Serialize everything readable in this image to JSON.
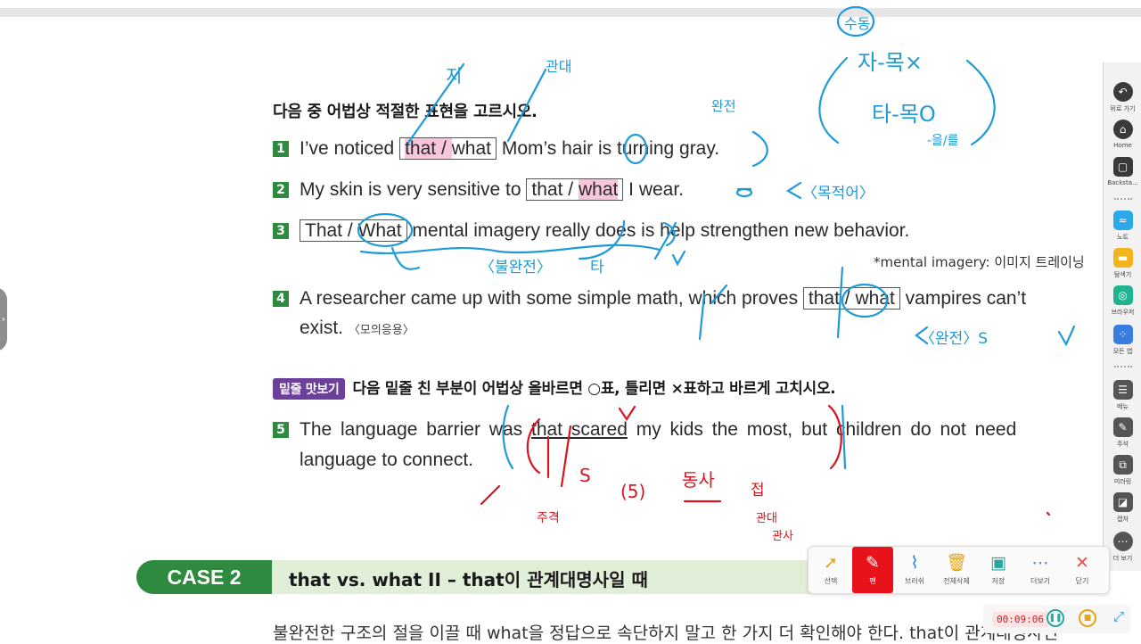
{
  "worksheet": {
    "title": "다음 중 어법상 적절한 표현을 고르시오.",
    "questions": [
      {
        "num": "1",
        "pre": "I’ve noticed",
        "choice_a": "that",
        "sep": " / ",
        "choice_b": "what",
        "post": "Mom’s hair is turning gray."
      },
      {
        "num": "2",
        "pre": "My skin is very sensitive to",
        "choice_a": "that",
        "sep": " / ",
        "choice_b": "what",
        "post": "I wear."
      },
      {
        "num": "3",
        "pre": "",
        "choice_a": "That",
        "sep": " / ",
        "choice_b": "What",
        "post": "mental imagery really does is help strengthen new behavior."
      },
      {
        "num": "4",
        "pre": "A researcher came up with some simple math, which proves",
        "choice_a": "that",
        "sep": " / ",
        "choice_b": "what",
        "post": "vampires can’t",
        "line2": "exist.",
        "source": "〈모의응용〉"
      }
    ],
    "note": "*mental imagery: 이미지 트레이닝",
    "badge": "밑줄 맛보기",
    "instruction": "다음 밑줄 친 부분이 어법상 올바르면 ○표, 틀리면 ×표하고 바르게 고치시오.",
    "q5": {
      "num": "5",
      "line1_a": "The language barrier was",
      "underlined": "that scared",
      "line1_b": "my kids the most, but children do not need",
      "line2": "language to connect."
    },
    "case_label": "CASE 2",
    "case_title": "that vs. what  II  –  that이 관계대명사일 때",
    "bottom_text": "불완전한 구조의 절을 이끌 때 what을 정답으로 속단하지 말고 한 가지 더 확인해야 한다. that이 관계대명사인"
  },
  "sidebar": {
    "items": [
      {
        "icon": "back-icon",
        "glyph": "↶",
        "label": "뒤로 가기"
      },
      {
        "icon": "home-icon",
        "glyph": "⌂",
        "label": "Home"
      },
      {
        "icon": "backstage-icon",
        "glyph": "▢",
        "label": "Backsta..."
      },
      {
        "icon": "note-app-icon",
        "glyph": "≈",
        "label": "노트"
      },
      {
        "icon": "explorer-icon",
        "glyph": "▬",
        "label": "탐색기"
      },
      {
        "icon": "browser-icon",
        "glyph": "◎",
        "label": "브라우저"
      },
      {
        "icon": "all-apps-icon",
        "glyph": "⁘",
        "label": "모든 앱"
      },
      {
        "icon": "menu-icon",
        "glyph": "☰",
        "label": "메뉴"
      },
      {
        "icon": "annotation-icon",
        "glyph": "✎",
        "label": "주석"
      },
      {
        "icon": "mirroring-icon",
        "glyph": "⧉",
        "label": "미러링"
      },
      {
        "icon": "capture-icon",
        "glyph": "◪",
        "label": "캡처"
      },
      {
        "icon": "more-icon",
        "glyph": "⋯",
        "label": "더 보기"
      }
    ]
  },
  "toolbar": {
    "tools": [
      {
        "icon": "select-cursor-icon",
        "glyph": "➚",
        "label": "선택",
        "color": "#e8a318"
      },
      {
        "icon": "pen-icon",
        "glyph": "✎",
        "label": "펜",
        "color": "#ffffff"
      },
      {
        "icon": "brush-icon",
        "glyph": "⌇",
        "label": "브러쉬",
        "color": "#2f7fd6"
      },
      {
        "icon": "clear-all-icon",
        "glyph": "🗑",
        "label": "전체삭제",
        "color": "#e8a318"
      },
      {
        "icon": "save-icon",
        "glyph": "▣",
        "label": "저장",
        "color": "#2aa6a0"
      },
      {
        "icon": "more-options-icon",
        "glyph": "⋯",
        "label": "더보기",
        "color": "#6a7fb5"
      },
      {
        "icon": "close-icon",
        "glyph": "✕",
        "label": "닫기",
        "color": "#e85050"
      }
    ]
  },
  "recording": {
    "time": "00:09:06"
  },
  "colors": {
    "green": "#2e8a3e",
    "purple": "#6b3f9a",
    "pink_highlight": "#f7c6dc",
    "blue_ink": "#1e9bd7",
    "red_ink": "#d8141e",
    "active_tool": "#e8121a"
  }
}
